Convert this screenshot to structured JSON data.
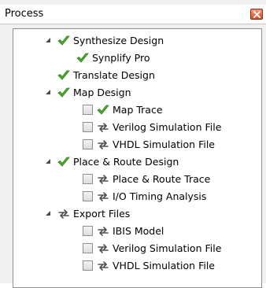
{
  "panel": {
    "title": "Process"
  },
  "tree": {
    "synthesize_design": "Synthesize Design",
    "synplify_pro": "Synplify Pro",
    "translate_design": "Translate Design",
    "map_design": "Map Design",
    "map_trace": "Map Trace",
    "map_verilog_sim": "Verilog Simulation File",
    "map_vhdl_sim": "VHDL Simulation File",
    "place_route_design": "Place & Route Design",
    "place_route_trace": "Place & Route Trace",
    "io_timing": "I/O Timing Analysis",
    "export_files": "Export Files",
    "ibis_model": "IBIS Model",
    "export_verilog_sim": "Verilog Simulation File",
    "export_vhdl_sim": "VHDL Simulation File"
  },
  "colors": {
    "check_green": "#4caf2e",
    "check_dark": "#2e7d1a",
    "refresh_gray": "#505050"
  }
}
